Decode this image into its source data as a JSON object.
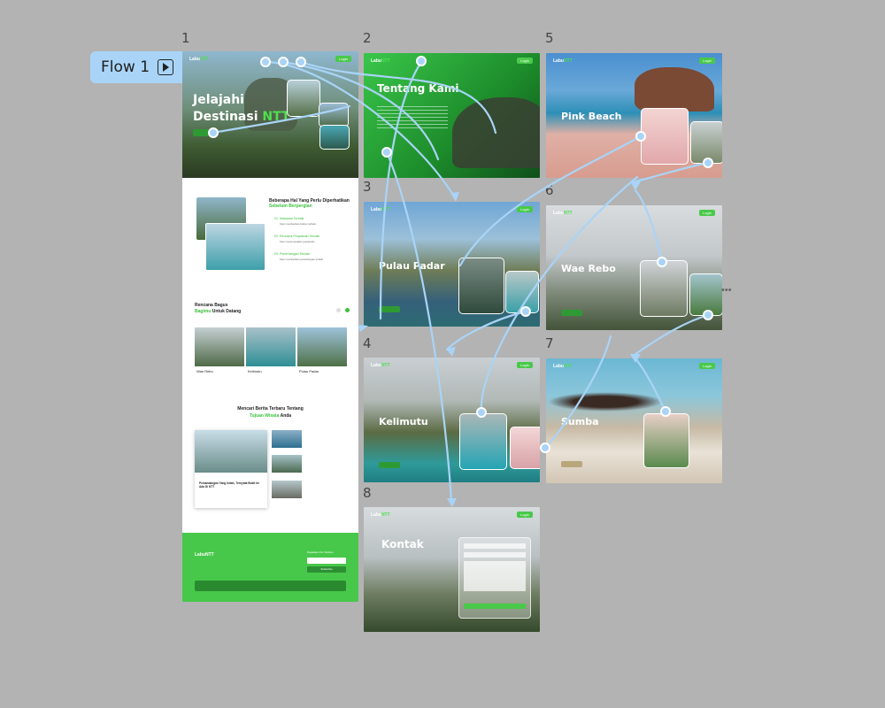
{
  "canvas": {
    "background": "#b3b3b3"
  },
  "flow": {
    "label": "Flow 1",
    "icon": "play-icon"
  },
  "frames": [
    {
      "num": "1"
    },
    {
      "num": "2"
    },
    {
      "num": "3"
    },
    {
      "num": "4"
    },
    {
      "num": "5"
    },
    {
      "num": "6"
    },
    {
      "num": "7"
    },
    {
      "num": "8"
    }
  ],
  "brand": {
    "logo_a": "Labu",
    "logo_b": "NTT",
    "login": "Login"
  },
  "home": {
    "hero_line1": "Jelajahi",
    "hero_line2a": "Destinasi ",
    "hero_line2b": "NTT",
    "section1_title_a": "Beberapa Hal Yang Perlu Diperhatikan ",
    "section1_title_b": "Sebelum Berpergian",
    "tips": [
      {
        "title": "01. Makanan Terbaik",
        "desc": "Kami memberikan kuliner terbaik"
      },
      {
        "title": "02. Rencana Perjalanan Terbaik",
        "desc": "Kami merencanakan perjalanan"
      },
      {
        "title": "03. Penerbangan Terbaik",
        "desc": "Kami memberikan penerbangan terbaik"
      }
    ],
    "plan_title_a": "Rencana Bagus",
    "plan_title_b": "Bagimu",
    "plan_title_c": " Untuk Datang",
    "places": [
      {
        "name": "Wae Rebo"
      },
      {
        "name": "Kelimutu"
      },
      {
        "name": "Pulau Padar"
      }
    ],
    "news_title_a": "Mencari Berita Terbaru Tentang",
    "news_title_b": "Tujuan Wisata",
    "news_title_c": " Anda",
    "news_main": "Pemandangan Yang Indah, Ternyata Bukit Ini Ada Di NTT",
    "footer_subscribe": "Subscribe",
    "footer_news_title": "Dapatkan Info Terbaru"
  },
  "pages": {
    "tentang": "Tentang Kami",
    "padar": "Pulau Padar",
    "kelimutu": "Kelimutu",
    "pink": "Pink Beach",
    "waerebo": "Wae Rebo",
    "sumba": "Sumba",
    "kontak": "Kontak"
  },
  "more_menu": "•••",
  "colors": {
    "accent": "#3dc13d",
    "link": "#a9d4f7"
  }
}
